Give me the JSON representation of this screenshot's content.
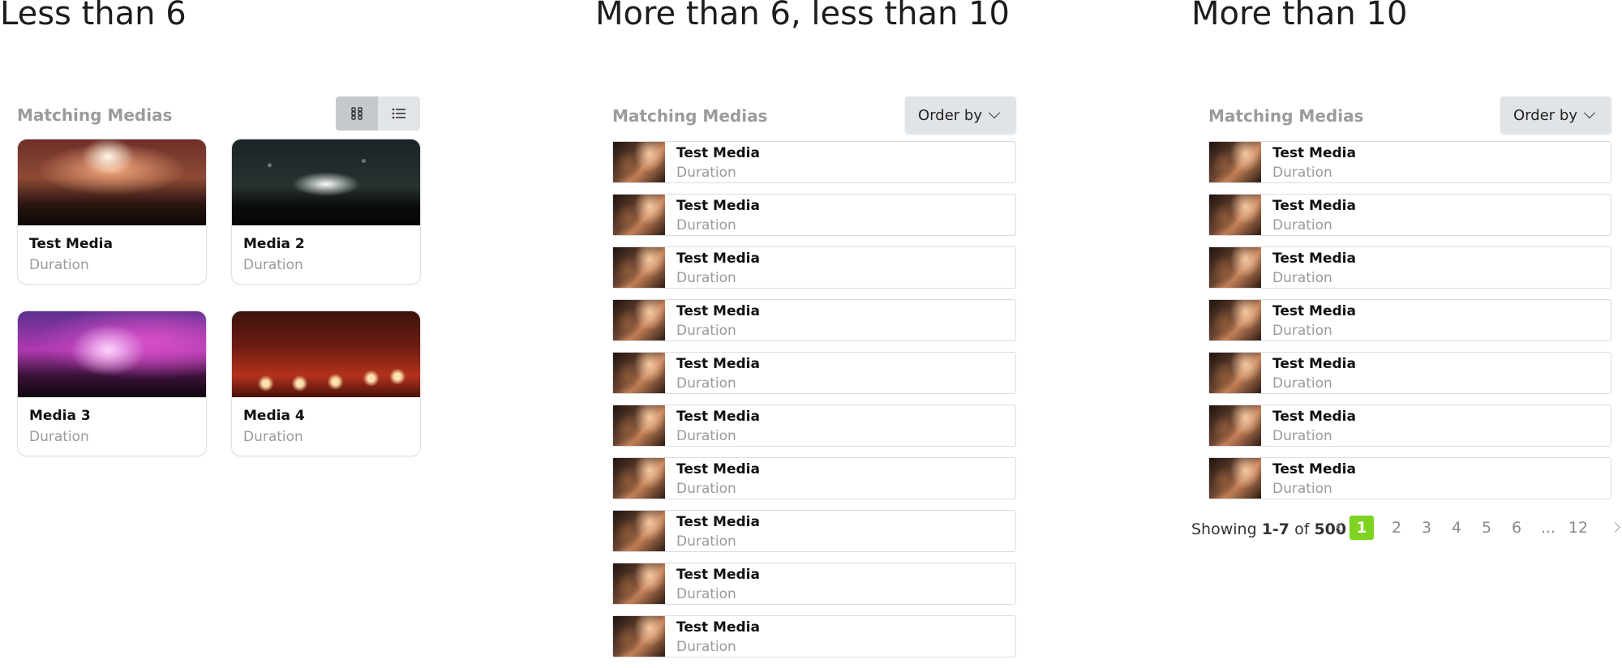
{
  "sections": {
    "less_than_6": {
      "title": "Less than 6"
    },
    "between_6_10": {
      "title": "More than 6, less than 10"
    },
    "more_than_10": {
      "title": "More than 10"
    }
  },
  "panel_heading": "Matching Medias",
  "order_by_label": "Order by",
  "view_toggle": {
    "active": "grid-view",
    "options": [
      "grid-view-icon",
      "list-view-icon"
    ]
  },
  "grid_cards": [
    {
      "title": "Test Media",
      "subtitle": "Duration",
      "image": "concert-hearts-photo"
    },
    {
      "title": "Media 2",
      "subtitle": "Duration",
      "image": "concert-confetti-photo"
    },
    {
      "title": "Media 3",
      "subtitle": "Duration",
      "image": "concert-purple-lights-photo"
    },
    {
      "title": "Media 4",
      "subtitle": "Duration",
      "image": "concert-red-stage-photo"
    }
  ],
  "list_medium": [
    {
      "title": "Test Media",
      "subtitle": "Duration"
    },
    {
      "title": "Test Media",
      "subtitle": "Duration"
    },
    {
      "title": "Test Media",
      "subtitle": "Duration"
    },
    {
      "title": "Test Media",
      "subtitle": "Duration"
    },
    {
      "title": "Test Media",
      "subtitle": "Duration"
    },
    {
      "title": "Test Media",
      "subtitle": "Duration"
    },
    {
      "title": "Test Media",
      "subtitle": "Duration"
    },
    {
      "title": "Test Media",
      "subtitle": "Duration"
    },
    {
      "title": "Test Media",
      "subtitle": "Duration"
    },
    {
      "title": "Test Media",
      "subtitle": "Duration"
    }
  ],
  "list_large": [
    {
      "title": "Test Media",
      "subtitle": "Duration"
    },
    {
      "title": "Test Media",
      "subtitle": "Duration"
    },
    {
      "title": "Test Media",
      "subtitle": "Duration"
    },
    {
      "title": "Test Media",
      "subtitle": "Duration"
    },
    {
      "title": "Test Media",
      "subtitle": "Duration"
    },
    {
      "title": "Test Media",
      "subtitle": "Duration"
    },
    {
      "title": "Test Media",
      "subtitle": "Duration"
    }
  ],
  "pagination": {
    "showing_prefix": "Showing",
    "range": "1-7",
    "of_word": "of",
    "total": "500",
    "pages": [
      "1",
      "2",
      "3",
      "4",
      "5",
      "6",
      "...",
      "12"
    ],
    "current_page": "1",
    "current_color": "#7ed321"
  }
}
